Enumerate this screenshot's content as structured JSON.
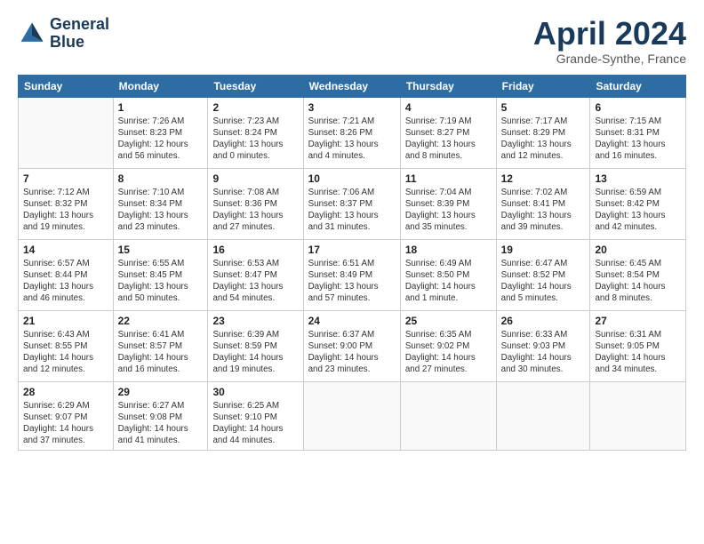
{
  "logo": {
    "line1": "General",
    "line2": "Blue"
  },
  "title": "April 2024",
  "subtitle": "Grande-Synthe, France",
  "days_of_week": [
    "Sunday",
    "Monday",
    "Tuesday",
    "Wednesday",
    "Thursday",
    "Friday",
    "Saturday"
  ],
  "weeks": [
    [
      {
        "day": "",
        "info": ""
      },
      {
        "day": "1",
        "info": "Sunrise: 7:26 AM\nSunset: 8:23 PM\nDaylight: 12 hours\nand 56 minutes."
      },
      {
        "day": "2",
        "info": "Sunrise: 7:23 AM\nSunset: 8:24 PM\nDaylight: 13 hours\nand 0 minutes."
      },
      {
        "day": "3",
        "info": "Sunrise: 7:21 AM\nSunset: 8:26 PM\nDaylight: 13 hours\nand 4 minutes."
      },
      {
        "day": "4",
        "info": "Sunrise: 7:19 AM\nSunset: 8:27 PM\nDaylight: 13 hours\nand 8 minutes."
      },
      {
        "day": "5",
        "info": "Sunrise: 7:17 AM\nSunset: 8:29 PM\nDaylight: 13 hours\nand 12 minutes."
      },
      {
        "day": "6",
        "info": "Sunrise: 7:15 AM\nSunset: 8:31 PM\nDaylight: 13 hours\nand 16 minutes."
      }
    ],
    [
      {
        "day": "7",
        "info": "Sunrise: 7:12 AM\nSunset: 8:32 PM\nDaylight: 13 hours\nand 19 minutes."
      },
      {
        "day": "8",
        "info": "Sunrise: 7:10 AM\nSunset: 8:34 PM\nDaylight: 13 hours\nand 23 minutes."
      },
      {
        "day": "9",
        "info": "Sunrise: 7:08 AM\nSunset: 8:36 PM\nDaylight: 13 hours\nand 27 minutes."
      },
      {
        "day": "10",
        "info": "Sunrise: 7:06 AM\nSunset: 8:37 PM\nDaylight: 13 hours\nand 31 minutes."
      },
      {
        "day": "11",
        "info": "Sunrise: 7:04 AM\nSunset: 8:39 PM\nDaylight: 13 hours\nand 35 minutes."
      },
      {
        "day": "12",
        "info": "Sunrise: 7:02 AM\nSunset: 8:41 PM\nDaylight: 13 hours\nand 39 minutes."
      },
      {
        "day": "13",
        "info": "Sunrise: 6:59 AM\nSunset: 8:42 PM\nDaylight: 13 hours\nand 42 minutes."
      }
    ],
    [
      {
        "day": "14",
        "info": "Sunrise: 6:57 AM\nSunset: 8:44 PM\nDaylight: 13 hours\nand 46 minutes."
      },
      {
        "day": "15",
        "info": "Sunrise: 6:55 AM\nSunset: 8:45 PM\nDaylight: 13 hours\nand 50 minutes."
      },
      {
        "day": "16",
        "info": "Sunrise: 6:53 AM\nSunset: 8:47 PM\nDaylight: 13 hours\nand 54 minutes."
      },
      {
        "day": "17",
        "info": "Sunrise: 6:51 AM\nSunset: 8:49 PM\nDaylight: 13 hours\nand 57 minutes."
      },
      {
        "day": "18",
        "info": "Sunrise: 6:49 AM\nSunset: 8:50 PM\nDaylight: 14 hours\nand 1 minute."
      },
      {
        "day": "19",
        "info": "Sunrise: 6:47 AM\nSunset: 8:52 PM\nDaylight: 14 hours\nand 5 minutes."
      },
      {
        "day": "20",
        "info": "Sunrise: 6:45 AM\nSunset: 8:54 PM\nDaylight: 14 hours\nand 8 minutes."
      }
    ],
    [
      {
        "day": "21",
        "info": "Sunrise: 6:43 AM\nSunset: 8:55 PM\nDaylight: 14 hours\nand 12 minutes."
      },
      {
        "day": "22",
        "info": "Sunrise: 6:41 AM\nSunset: 8:57 PM\nDaylight: 14 hours\nand 16 minutes."
      },
      {
        "day": "23",
        "info": "Sunrise: 6:39 AM\nSunset: 8:59 PM\nDaylight: 14 hours\nand 19 minutes."
      },
      {
        "day": "24",
        "info": "Sunrise: 6:37 AM\nSunset: 9:00 PM\nDaylight: 14 hours\nand 23 minutes."
      },
      {
        "day": "25",
        "info": "Sunrise: 6:35 AM\nSunset: 9:02 PM\nDaylight: 14 hours\nand 27 minutes."
      },
      {
        "day": "26",
        "info": "Sunrise: 6:33 AM\nSunset: 9:03 PM\nDaylight: 14 hours\nand 30 minutes."
      },
      {
        "day": "27",
        "info": "Sunrise: 6:31 AM\nSunset: 9:05 PM\nDaylight: 14 hours\nand 34 minutes."
      }
    ],
    [
      {
        "day": "28",
        "info": "Sunrise: 6:29 AM\nSunset: 9:07 PM\nDaylight: 14 hours\nand 37 minutes."
      },
      {
        "day": "29",
        "info": "Sunrise: 6:27 AM\nSunset: 9:08 PM\nDaylight: 14 hours\nand 41 minutes."
      },
      {
        "day": "30",
        "info": "Sunrise: 6:25 AM\nSunset: 9:10 PM\nDaylight: 14 hours\nand 44 minutes."
      },
      {
        "day": "",
        "info": ""
      },
      {
        "day": "",
        "info": ""
      },
      {
        "day": "",
        "info": ""
      },
      {
        "day": "",
        "info": ""
      }
    ]
  ]
}
